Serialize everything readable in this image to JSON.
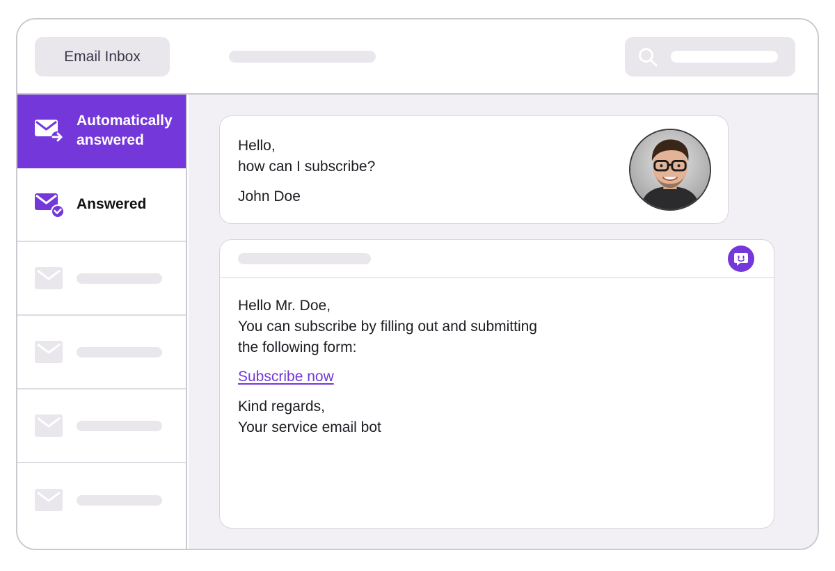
{
  "header": {
    "app_title": "Email Inbox"
  },
  "sidebar": {
    "items": [
      {
        "label_line1": "Automatically",
        "label_line2": "answered",
        "icon": "mail-forward-icon",
        "active": true
      },
      {
        "label": "Answered",
        "icon": "mail-check-icon",
        "active": false
      }
    ]
  },
  "message": {
    "line1": "Hello,",
    "line2": "how can I subscribe?",
    "sender": "John Doe"
  },
  "reply": {
    "line1": "Hello Mr. Doe,",
    "line2": "You can subscribe by filling out and submitting",
    "line3": "the following form:",
    "link_label": "Subscribe now",
    "closing1": "Kind regards,",
    "closing2": "Your service email bot"
  },
  "colors": {
    "accent": "#7437d9",
    "placeholder": "#e9e6ec",
    "border": "#cbc8d0",
    "main_bg": "#f2f0f5"
  }
}
